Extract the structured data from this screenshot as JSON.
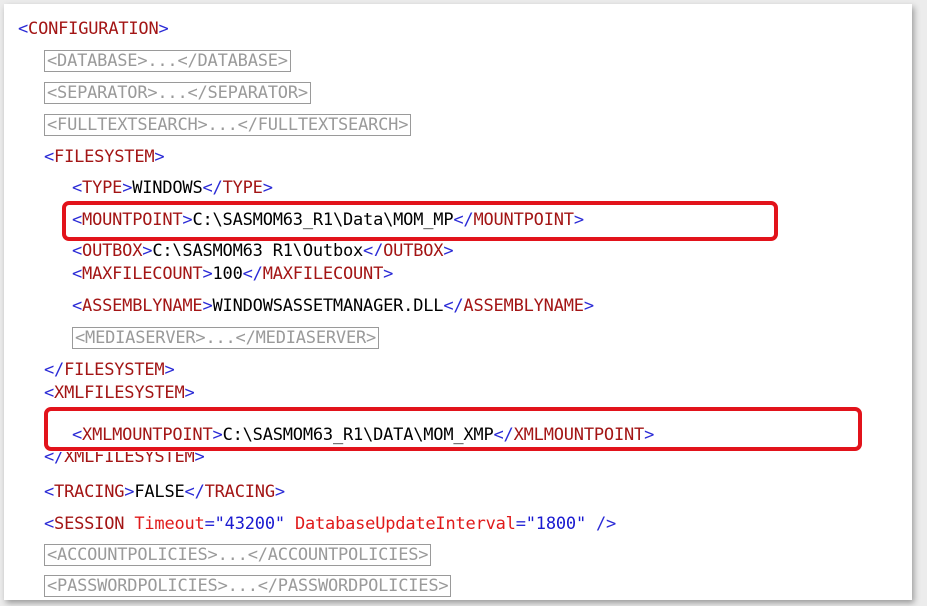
{
  "lines": {
    "configuration_open": {
      "tag": "CONFIGURATION"
    },
    "database": {
      "text": "<DATABASE>...</DATABASE>"
    },
    "separator": {
      "text": "<SEPARATOR>...</SEPARATOR>"
    },
    "fulltextsearch": {
      "text": "<FULLTEXTSEARCH>...</FULLTEXTSEARCH>"
    },
    "filesystem_open": {
      "tag": "FILESYSTEM"
    },
    "type": {
      "tag": "TYPE",
      "value": "WINDOWS"
    },
    "mountpoint": {
      "tag": "MOUNTPOINT",
      "value": "C:\\SASMOM63_R1\\Data\\MOM_MP"
    },
    "outbox": {
      "tag": "OUTBOX",
      "value": "C:\\SASMOM63_R1\\Outbox"
    },
    "maxfilecount": {
      "tag": "MAXFILECOUNT",
      "value": "100"
    },
    "assemblyname": {
      "tag": "ASSEMBLYNAME",
      "value": "WINDOWSASSETMANAGER.DLL"
    },
    "mediaserver": {
      "text": "<MEDIASERVER>...</MEDIASERVER>"
    },
    "filesystem_close": {
      "tag": "FILESYSTEM"
    },
    "xmlfilesystem_open": {
      "tag": "XMLFILESYSTEM"
    },
    "xmlmountpoint": {
      "tag": "XMLMOUNTPOINT",
      "value": "C:\\SASMOM63_R1\\DATA\\MOM_XMP"
    },
    "xmlfilesystem_close": {
      "tag": "XMLFILESYSTEM"
    },
    "tracing": {
      "tag": "TRACING",
      "value": "FALSE"
    },
    "session": {
      "tag": "SESSION",
      "attr1_name": "Timeout",
      "attr1_value": "\"43200\"",
      "attr2_name": "DatabaseUpdateInterval",
      "attr2_value": "\"1800\""
    },
    "accountpolicies": {
      "text": "<ACCOUNTPOLICIES>...</ACCOUNTPOLICIES>"
    },
    "passwordpolicies": {
      "text": "<PASSWORDPOLICIES>...</PASSWORDPOLICIES>"
    }
  },
  "symbols": {
    "lt": "<",
    "gt": ">",
    "ltslash": "</",
    "selfclose": " />",
    "eq": "=",
    "space": " "
  },
  "colors": {
    "highlight": "#e2131b",
    "tag": "#a31515",
    "bracket": "#2a2ad6",
    "attribute": "#e01a1a",
    "attr_value": "#1a1ad0"
  }
}
